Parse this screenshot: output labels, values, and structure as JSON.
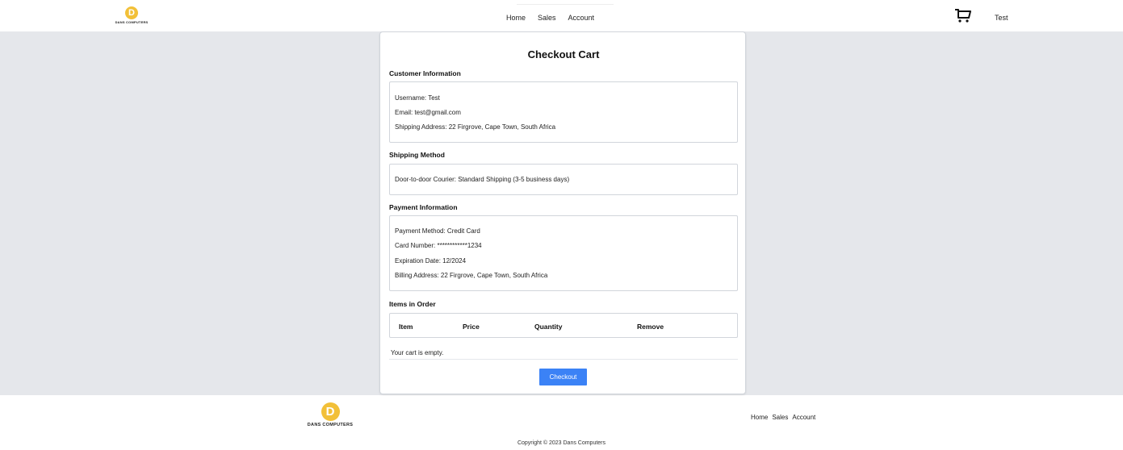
{
  "brand": {
    "initial": "D",
    "name": "DANS COMPUTERS",
    "color": "#f2c038"
  },
  "nav": {
    "items": [
      "Home",
      "Sales",
      "Account"
    ]
  },
  "header": {
    "user": "Test"
  },
  "checkout": {
    "title": "Checkout Cart",
    "customer": {
      "heading": "Customer Information",
      "username": "Username: Test",
      "email": "Email: test@gmail.com",
      "shipping_address": "Shipping Address: 22 Firgrove, Cape Town, South Africa"
    },
    "shipping": {
      "heading": "Shipping Method",
      "method": "Door-to-door Courier: Standard Shipping (3-5 business days)"
    },
    "payment": {
      "heading": "Payment Information",
      "method": "Payment Method: Credit Card",
      "card": "Card Number: ************1234",
      "expiry": "Expiration Date: 12/2024",
      "billing": "Billing Address: 22 Firgrove, Cape Town, South Africa"
    },
    "items": {
      "heading": "Items in Order",
      "columns": [
        "Item",
        "Price",
        "Quantity",
        "Remove"
      ],
      "empty_text": "Your cart is empty."
    },
    "checkout_label": "Checkout",
    "accent": "#3b82f6"
  },
  "footer": {
    "nav": [
      "Home",
      "Sales",
      "Account"
    ],
    "copyright": "Copyright © 2023 Dans Computers"
  }
}
